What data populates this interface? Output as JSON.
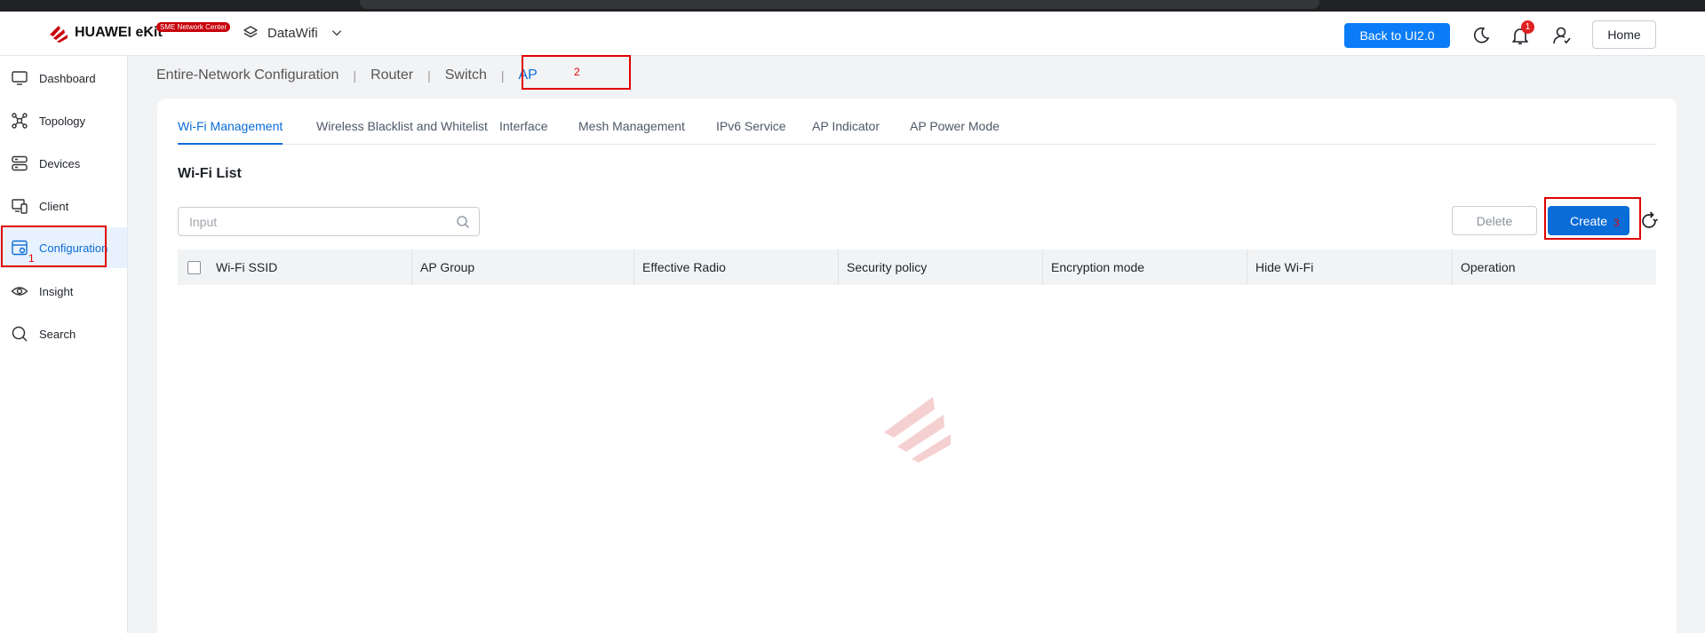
{
  "header": {
    "brand": "HUAWEI eKit",
    "badge": "SME Network Center",
    "site_name": "DataWifi",
    "back_button": "Back to UI2.0",
    "notification_count": "1",
    "home_button": "Home"
  },
  "sidebar": {
    "items": [
      {
        "label": "Dashboard",
        "icon": "monitor-icon"
      },
      {
        "label": "Topology",
        "icon": "topology-icon"
      },
      {
        "label": "Devices",
        "icon": "devices-icon"
      },
      {
        "label": "Client",
        "icon": "client-icon"
      },
      {
        "label": "Configuration",
        "icon": "configuration-icon",
        "active": true
      },
      {
        "label": "Insight",
        "icon": "eye-icon"
      },
      {
        "label": "Search",
        "icon": "search-icon"
      }
    ]
  },
  "breadcrumb": {
    "items": [
      "Entire-Network Configuration",
      "Router",
      "Switch",
      "AP"
    ],
    "separator": "|"
  },
  "tabs": [
    "Wi-Fi Management",
    "Wireless Blacklist and Whitelist",
    "Interface",
    "Mesh Management",
    "IPv6 Service",
    "AP Indicator",
    "AP Power Mode"
  ],
  "main": {
    "section_title": "Wi-Fi List",
    "search_placeholder": "Input",
    "delete_button": "Delete",
    "create_button": "Create",
    "columns": [
      "Wi-Fi SSID",
      "AP Group",
      "Effective Radio",
      "Security policy",
      "Encryption mode",
      "Hide Wi-Fi",
      "Operation"
    ]
  },
  "annotations": [
    "1",
    "2",
    "3"
  ],
  "colors": {
    "accent": "#0a6cd6",
    "back_button": "#0a7cf7",
    "brand_red": "#c7000b",
    "annotation": "#e00000"
  }
}
